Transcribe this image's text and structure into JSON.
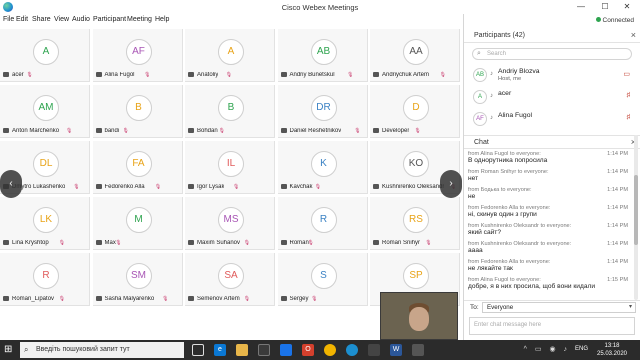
{
  "window": {
    "title": "Cisco Webex Meetings",
    "minimize": "—",
    "maximize": "☐",
    "close": "✕"
  },
  "menu": [
    "File",
    "Edit",
    "Share",
    "View",
    "Audio",
    "Participant",
    "Meeting",
    "Help"
  ],
  "status": {
    "label": "Connected",
    "dot_color": "#2ea44f"
  },
  "grid": [
    {
      "initials": "A",
      "name": "acer",
      "color": "#2ea44f"
    },
    {
      "initials": "AF",
      "name": "Alina Fugol",
      "color": "#a855b5"
    },
    {
      "initials": "A",
      "name": "Anatoliy",
      "color": "#e8a317"
    },
    {
      "initials": "AB",
      "name": "Andriy Bunetskul",
      "color": "#2ea44f"
    },
    {
      "initials": "AA",
      "name": "Andriychuk Artem",
      "color": "#555555"
    },
    {
      "initials": "AM",
      "name": "Anton Marchenko",
      "color": "#2ea44f"
    },
    {
      "initials": "B",
      "name": "bandi",
      "color": "#e8a317"
    },
    {
      "initials": "B",
      "name": "Bohdan",
      "color": "#2ea44f"
    },
    {
      "initials": "DR",
      "name": "Daniel Reshetnikov",
      "color": "#3b82c4"
    },
    {
      "initials": "D",
      "name": "Developer",
      "color": "#e8a317"
    },
    {
      "initials": "DL",
      "name": "Dmytro Lukashenko",
      "color": "#e8a317"
    },
    {
      "initials": "FA",
      "name": "Fedorenko Alla",
      "color": "#e8a317"
    },
    {
      "initials": "IL",
      "name": "Igor Lysak",
      "color": "#e05a5a"
    },
    {
      "initials": "K",
      "name": "Kavchak",
      "color": "#3b82c4"
    },
    {
      "initials": "KO",
      "name": "Kushnirenko Oleksandr",
      "color": "#555555"
    },
    {
      "initials": "LK",
      "name": "Lina Kryshtop",
      "color": "#e8a317"
    },
    {
      "initials": "M",
      "name": "Max",
      "color": "#2ea44f"
    },
    {
      "initials": "MS",
      "name": "Maxim Suhanov",
      "color": "#a855b5"
    },
    {
      "initials": "R",
      "name": "Roman",
      "color": "#3b82c4"
    },
    {
      "initials": "RS",
      "name": "Roman Snihyr",
      "color": "#e8a317"
    },
    {
      "initials": "R",
      "name": "Roman_Lipatov",
      "color": "#e05a5a"
    },
    {
      "initials": "SM",
      "name": "Sasha Malyarenko",
      "color": "#a855b5"
    },
    {
      "initials": "SA",
      "name": "Semenov Artem",
      "color": "#e05a5a"
    },
    {
      "initials": "S",
      "name": "Sergey",
      "color": "#3b82c4"
    },
    {
      "initials": "SP",
      "name": "",
      "color": "#e8a317"
    }
  ],
  "participants_panel": {
    "title": "Participants (42)",
    "search_placeholder": "Search",
    "list": [
      {
        "initials": "AB",
        "name": "Andriy Blozva",
        "sub": "Host, me",
        "color": "#2ea44f"
      },
      {
        "initials": "A",
        "name": "acer",
        "sub": "",
        "color": "#2ea44f"
      },
      {
        "initials": "AF",
        "name": "Alina Fugol",
        "sub": "",
        "color": "#a855b5"
      }
    ]
  },
  "chat_panel": {
    "title": "Chat",
    "messages": [
      {
        "from": "from Alina Fugol to everyone:",
        "time": "1:14 PM",
        "text": "В однорутника попросила"
      },
      {
        "from": "from Roman Snihyr to everyone:",
        "time": "1:14 PM",
        "text": "нет"
      },
      {
        "from": "from Бодька to everyone:",
        "time": "1:14 PM",
        "text": "не"
      },
      {
        "from": "from Fedorenko Alla to everyone:",
        "time": "1:14 PM",
        "text": "ні, скинув один з групи"
      },
      {
        "from": "from Kushnirenko Oleksandr to everyone:",
        "time": "1:14 PM",
        "text": "який сайт?"
      },
      {
        "from": "from Kushnirenko Oleksandr to everyone:",
        "time": "1:14 PM",
        "text": "аааа"
      },
      {
        "from": "from Fedorenko Alla to everyone:",
        "time": "1:14 PM",
        "text": "не лякайте так"
      },
      {
        "from": "from Alina Fugol to everyone:",
        "time": "1:15 PM",
        "text": "добре, я в них просила, щоб вони кидали"
      }
    ],
    "to_label": "To:",
    "to_value": "Everyone",
    "input_placeholder": "Enter chat message here"
  },
  "taskbar": {
    "search_placeholder": "Введіть пошуковий запит тут",
    "lang": "ENG",
    "time": "13:18",
    "date": "25.03.2020"
  }
}
